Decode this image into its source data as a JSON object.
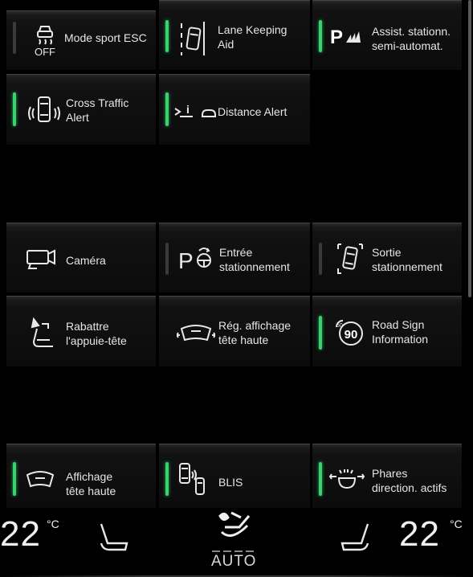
{
  "tiles": [
    {
      "label": "Mode sport ESC",
      "icon": "esc-off-icon",
      "indicator": "off"
    },
    {
      "label": "Lane Keeping\nAid",
      "icon": "lane-keeping-icon",
      "indicator": "on"
    },
    {
      "label": "Assist. stationn.\nsemi-automat.",
      "icon": "park-assist-icon",
      "indicator": "on"
    },
    {
      "label": "Cross Traffic\nAlert",
      "icon": "cross-traffic-icon",
      "indicator": "on"
    },
    {
      "label": "Distance Alert",
      "icon": "distance-alert-icon",
      "indicator": "on"
    },
    {
      "label": "Caméra",
      "icon": "camera-icon",
      "indicator": "none"
    },
    {
      "label": "Entrée\nstationnement",
      "icon": "park-in-icon",
      "indicator": "off"
    },
    {
      "label": "Sortie\nstationnement",
      "icon": "park-out-icon",
      "indicator": "off"
    },
    {
      "label": "Rabattre\nl'appuie-tête",
      "icon": "headrest-fold-icon",
      "indicator": "none"
    },
    {
      "label": "Rég. affichage\ntête haute",
      "icon": "hud-adjust-icon",
      "indicator": "none"
    },
    {
      "label": "Road Sign\nInformation",
      "icon": "road-sign-icon",
      "indicator": "on",
      "sign_text": "90"
    },
    {
      "label": "Affichage\ntête haute",
      "icon": "hud-icon",
      "indicator": "on"
    },
    {
      "label": "BLIS",
      "icon": "blis-icon",
      "indicator": "on"
    },
    {
      "label": "Phares\ndirection. actifs",
      "icon": "active-headlights-icon",
      "indicator": "on"
    }
  ],
  "climate": {
    "left_temp": "22",
    "right_temp": "22",
    "unit": "°C",
    "fan_mode": "AUTO"
  },
  "colors": {
    "indicator_on": "#39d26e",
    "indicator_off": "#3a3a3a",
    "background": "#000000"
  }
}
